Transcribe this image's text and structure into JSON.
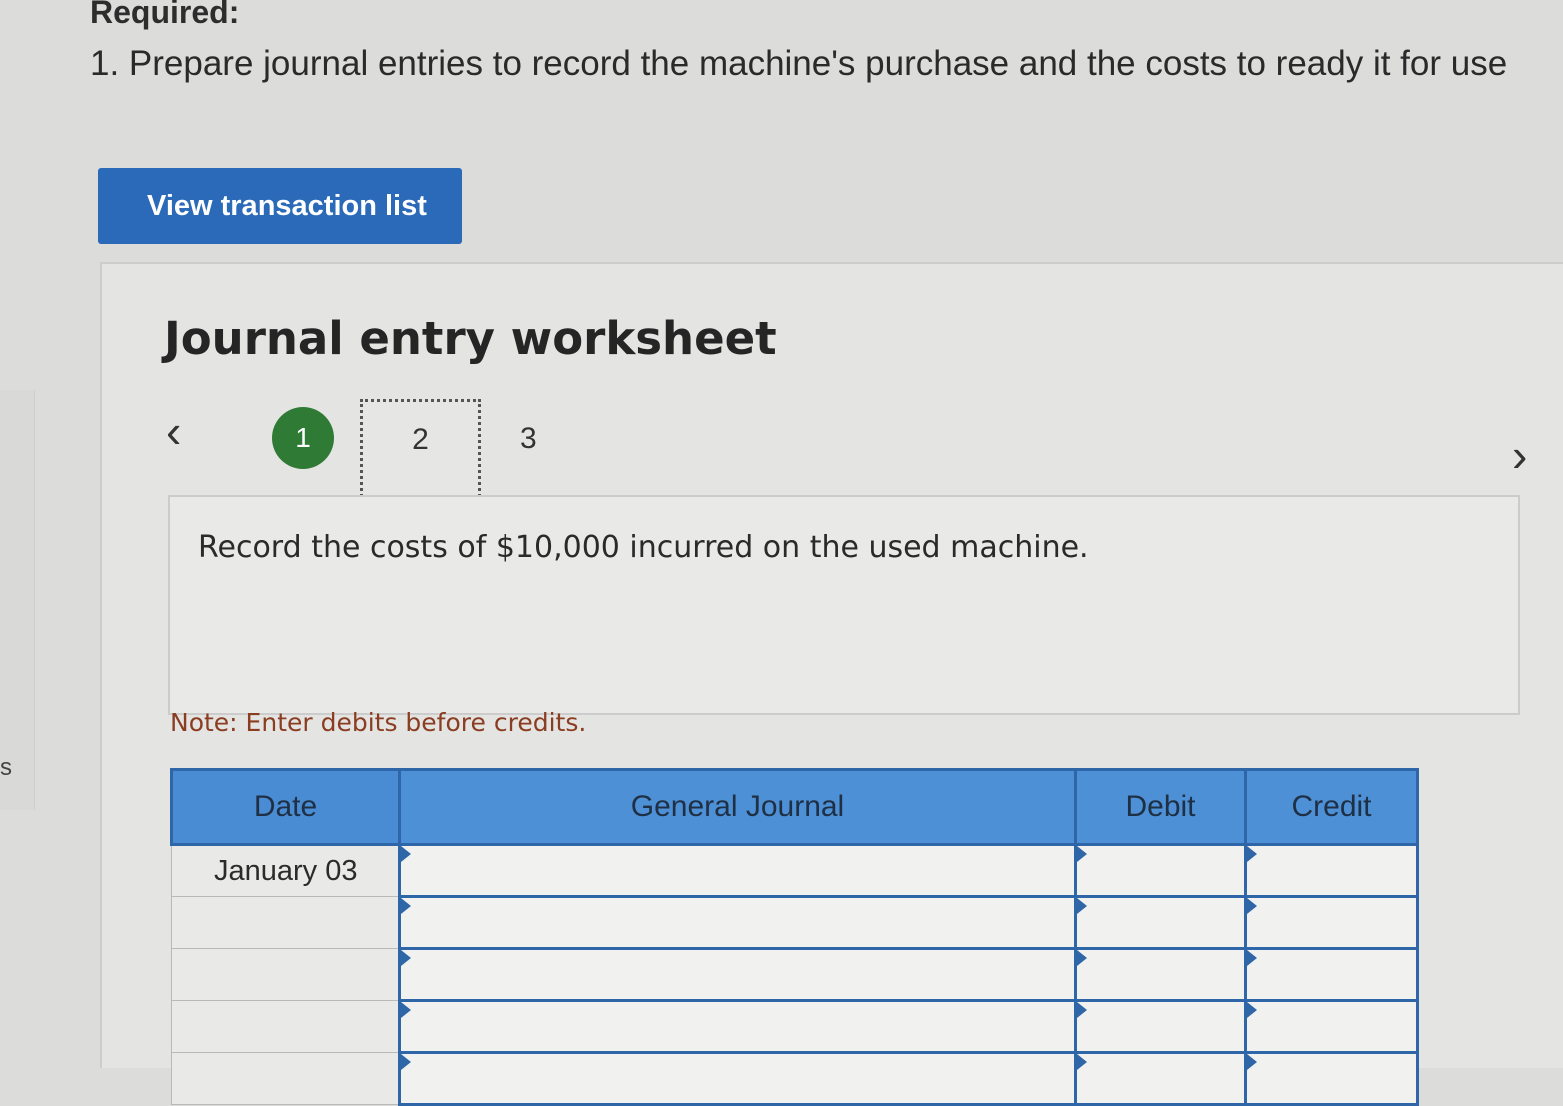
{
  "required": {
    "heading": "Required:",
    "instruction": "1. Prepare journal entries to record the machine's purchase and the costs to ready it for use"
  },
  "view_transaction_button": "View transaction list",
  "worksheet": {
    "title": "Journal entry worksheet",
    "prev_icon": "chevron-left-icon",
    "next_icon": "chevron-right-icon",
    "steps": [
      "1",
      "2",
      "3"
    ],
    "current_step": "2",
    "completed_step_color": "#2f7a35",
    "record_text": "Record the costs of $10,000 incurred on the used machine.",
    "note": "Note: Enter debits before credits."
  },
  "table": {
    "headers": {
      "date": "Date",
      "general_journal": "General Journal",
      "debit": "Debit",
      "credit": "Credit"
    },
    "header_color": "#4d90d6",
    "rows": [
      {
        "date": "January 03",
        "general_journal": "",
        "debit": "",
        "credit": ""
      },
      {
        "date": "",
        "general_journal": "",
        "debit": "",
        "credit": ""
      },
      {
        "date": "",
        "general_journal": "",
        "debit": "",
        "credit": ""
      },
      {
        "date": "",
        "general_journal": "",
        "debit": "",
        "credit": ""
      },
      {
        "date": "",
        "general_journal": "",
        "debit": "",
        "credit": ""
      }
    ]
  },
  "left_edge_text": "s"
}
